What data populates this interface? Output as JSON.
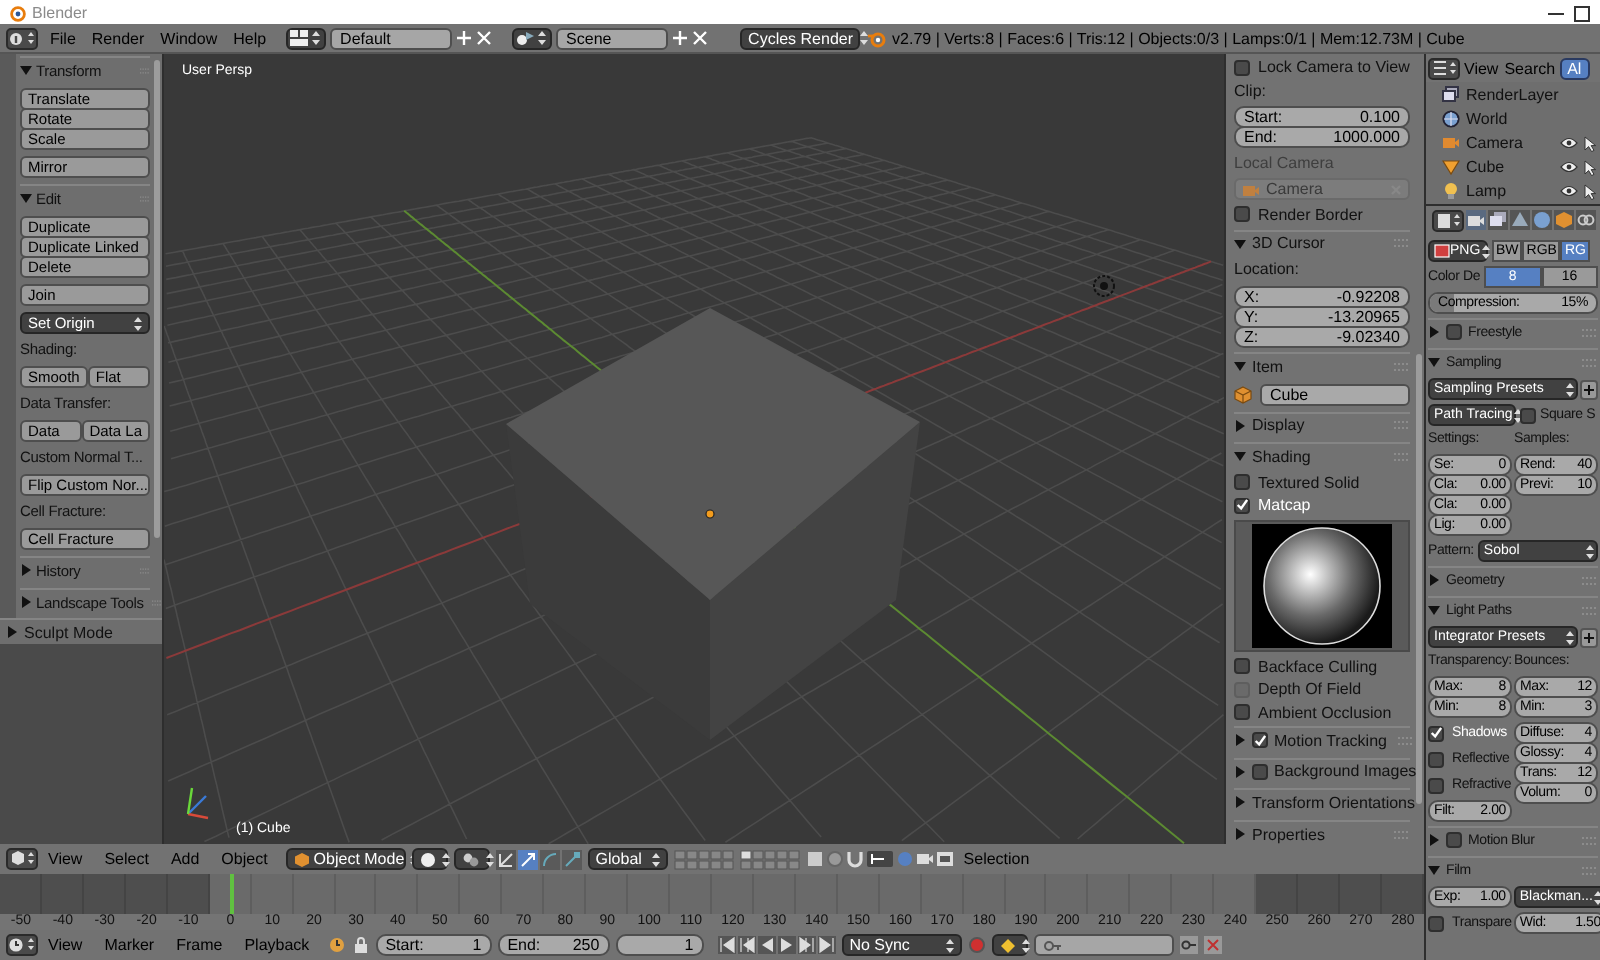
{
  "window": {
    "title": "Blender"
  },
  "info_header": {
    "menus": [
      "File",
      "Render",
      "Window",
      "Help"
    ],
    "layout": "Default",
    "scene": "Scene",
    "engine": "Cycles Render",
    "stats": "v2.79 | Verts:8 | Faces:6 | Tris:12 | Objects:0/3 | Lamps:0/1 | Mem:12.73M | Cube"
  },
  "tool_shelf": {
    "rows": [
      {
        "kind": "panel",
        "label": "Transform",
        "expanded": true
      },
      {
        "kind": "stack",
        "buttons": [
          "Translate",
          "Rotate",
          "Scale"
        ]
      },
      {
        "kind": "stack",
        "buttons": [
          "Mirror"
        ]
      },
      {
        "kind": "panel",
        "label": "Edit",
        "expanded": true
      },
      {
        "kind": "stack",
        "buttons": [
          "Duplicate",
          "Duplicate Linked",
          "Delete"
        ]
      },
      {
        "kind": "stack",
        "buttons": [
          "Join"
        ]
      },
      {
        "kind": "select",
        "label": "Set Origin"
      },
      {
        "kind": "label",
        "label": "Shading:"
      },
      {
        "kind": "row",
        "buttons": [
          "Smooth",
          "Flat"
        ]
      },
      {
        "kind": "label",
        "label": "Data Transfer:"
      },
      {
        "kind": "row",
        "buttons": [
          "Data",
          "Data La"
        ]
      },
      {
        "kind": "label",
        "label": "Custom Normal T..."
      },
      {
        "kind": "stack",
        "buttons": [
          "Flip Custom Nor..."
        ]
      },
      {
        "kind": "label",
        "label": "Cell Fracture:"
      },
      {
        "kind": "stack",
        "buttons": [
          "Cell Fracture"
        ]
      },
      {
        "kind": "panel",
        "label": "History",
        "expanded": false
      },
      {
        "kind": "panel",
        "label": "Landscape Tools",
        "expanded": false
      }
    ],
    "mode_panel": {
      "label": "Sculpt Mode",
      "expanded": false
    }
  },
  "viewport": {
    "view_name": "User Persp",
    "object_name": "(1) Cube"
  },
  "n_panel": {
    "rows": [
      {
        "kind": "check",
        "label": "Lock Camera to View",
        "checked": false
      },
      {
        "kind": "label",
        "label": "Clip:"
      },
      {
        "kind": "numbers",
        "fields": [
          {
            "label": "Start:",
            "value": "0.100"
          },
          {
            "label": "End:",
            "value": "1000.000"
          }
        ]
      },
      {
        "kind": "label",
        "label": "Local Camera",
        "disabled": true
      },
      {
        "kind": "object_field",
        "label": "Camera",
        "disabled": true
      },
      {
        "kind": "check",
        "label": "Render Border",
        "checked": false
      },
      {
        "kind": "panel",
        "label": "3D Cursor",
        "expanded": true
      },
      {
        "kind": "label",
        "label": "Location:"
      },
      {
        "kind": "numbers",
        "fields": [
          {
            "label": "X:",
            "value": "-0.92208"
          },
          {
            "label": "Y:",
            "value": "-13.20965"
          },
          {
            "label": "Z:",
            "value": "-9.02340"
          }
        ]
      },
      {
        "kind": "panel",
        "label": "Item",
        "expanded": true
      },
      {
        "kind": "name_field",
        "value": "Cube"
      },
      {
        "kind": "panel",
        "label": "Display",
        "expanded": false
      },
      {
        "kind": "panel",
        "label": "Shading",
        "expanded": true
      },
      {
        "kind": "check",
        "label": "Textured Solid",
        "checked": false
      },
      {
        "kind": "check",
        "label": "Matcap",
        "checked": true
      },
      {
        "kind": "preview"
      },
      {
        "kind": "check",
        "label": "Backface Culling",
        "checked": false
      },
      {
        "kind": "check",
        "label": "Depth Of Field",
        "checked": false,
        "disabled": true
      },
      {
        "kind": "check",
        "label": "Ambient Occlusion",
        "checked": false
      },
      {
        "kind": "panel",
        "label": "Motion Tracking",
        "expanded": false,
        "checked": true
      },
      {
        "kind": "panel",
        "label": "Background Images",
        "expanded": false,
        "checked": false
      },
      {
        "kind": "panel",
        "label": "Transform Orientations",
        "expanded": false
      },
      {
        "kind": "panel",
        "label": "Properties",
        "expanded": false
      }
    ]
  },
  "view3d_header": {
    "menus": [
      "View",
      "Select",
      "Add",
      "Object"
    ],
    "mode": "Object Mode",
    "orientation": "Global",
    "label": "Selection"
  },
  "timeline": {
    "ticks": [
      {
        "label": "-50",
        "in_range": false,
        "current": false
      },
      {
        "label": "-40",
        "in_range": false,
        "current": false
      },
      {
        "label": "-30",
        "in_range": false,
        "current": false
      },
      {
        "label": "-20",
        "in_range": false,
        "current": false
      },
      {
        "label": "-10",
        "in_range": false,
        "current": false
      },
      {
        "label": "0",
        "in_range": true,
        "current": true
      },
      {
        "label": "10",
        "in_range": true,
        "current": false
      },
      {
        "label": "20",
        "in_range": true,
        "current": false
      },
      {
        "label": "30",
        "in_range": true,
        "current": false
      },
      {
        "label": "40",
        "in_range": true,
        "current": false
      },
      {
        "label": "50",
        "in_range": true,
        "current": false
      },
      {
        "label": "60",
        "in_range": true,
        "current": false
      },
      {
        "label": "70",
        "in_range": true,
        "current": false
      },
      {
        "label": "80",
        "in_range": true,
        "current": false
      },
      {
        "label": "90",
        "in_range": true,
        "current": false
      },
      {
        "label": "100",
        "in_range": true,
        "current": false
      },
      {
        "label": "110",
        "in_range": true,
        "current": false
      },
      {
        "label": "120",
        "in_range": true,
        "current": false
      },
      {
        "label": "130",
        "in_range": true,
        "current": false
      },
      {
        "label": "140",
        "in_range": true,
        "current": false
      },
      {
        "label": "150",
        "in_range": true,
        "current": false
      },
      {
        "label": "160",
        "in_range": true,
        "current": false
      },
      {
        "label": "170",
        "in_range": true,
        "current": false
      },
      {
        "label": "180",
        "in_range": true,
        "current": false
      },
      {
        "label": "190",
        "in_range": true,
        "current": false
      },
      {
        "label": "200",
        "in_range": true,
        "current": false
      },
      {
        "label": "210",
        "in_range": true,
        "current": false
      },
      {
        "label": "220",
        "in_range": true,
        "current": false
      },
      {
        "label": "230",
        "in_range": true,
        "current": false
      },
      {
        "label": "240",
        "in_range": true,
        "current": false
      },
      {
        "label": "250",
        "in_range": false,
        "current": false
      },
      {
        "label": "260",
        "in_range": false,
        "current": false
      },
      {
        "label": "270",
        "in_range": false,
        "current": false
      },
      {
        "label": "280",
        "in_range": false,
        "current": false
      }
    ]
  },
  "timeline_header": {
    "menus": [
      "View",
      "Marker",
      "Frame",
      "Playback"
    ],
    "start": {
      "label": "Start:",
      "value": "1"
    },
    "end": {
      "label": "End:",
      "value": "250"
    },
    "frame": "1",
    "sync": "No Sync"
  },
  "outliner": {
    "menus": [
      "View",
      "Search"
    ],
    "filter": "Al",
    "items": [
      {
        "label": "RenderLayer",
        "kind": "renderlayer"
      },
      {
        "label": "World",
        "kind": "world"
      },
      {
        "label": "Camera",
        "kind": "camera"
      },
      {
        "label": "Cube",
        "kind": "mesh"
      },
      {
        "label": "Lamp",
        "kind": "lamp"
      }
    ]
  },
  "properties": {
    "rows": [
      {
        "kind": "format",
        "select": "PNG",
        "options": [
          {
            "label": "BW",
            "selected": false
          },
          {
            "label": "RGB",
            "selected": false
          },
          {
            "label": "RG",
            "selected": true
          }
        ]
      },
      {
        "kind": "toggle",
        "label": "Color De",
        "options": [
          {
            "label": "8",
            "selected": true
          },
          {
            "label": "16",
            "selected": false
          }
        ]
      },
      {
        "kind": "slider",
        "label": "Compression:",
        "value": "15%",
        "level": 0.15
      },
      {
        "kind": "panel",
        "label": "Freestyle",
        "expanded": false,
        "checked": false
      },
      {
        "kind": "panel",
        "label": "Sampling",
        "expanded": true
      },
      {
        "kind": "preset",
        "label": "Sampling Presets"
      },
      {
        "kind": "select_check",
        "select": "Path Tracing",
        "label": "Square S",
        "checked": false
      },
      {
        "kind": "columns",
        "columns": [
          {
            "rows": [
              {
                "kind": "label",
                "label": "Settings:"
              },
              {
                "kind": "numbers",
                "fields": [
                  {
                    "label": "Se:",
                    "value": "0"
                  },
                  {
                    "label": "Cla:",
                    "value": "0.00"
                  },
                  {
                    "label": "Cla:",
                    "value": "0.00"
                  },
                  {
                    "label": "Lig:",
                    "value": "0.00"
                  }
                ]
              }
            ]
          },
          {
            "rows": [
              {
                "kind": "label",
                "label": "Samples:"
              },
              {
                "kind": "numbers",
                "fields": [
                  {
                    "label": "Rend:",
                    "value": "40"
                  },
                  {
                    "label": "Previ:",
                    "value": "10"
                  }
                ]
              }
            ]
          }
        ]
      },
      {
        "kind": "labeled_select",
        "label": "Pattern:",
        "select": "Sobol"
      },
      {
        "kind": "panel",
        "label": "Geometry",
        "expanded": false
      },
      {
        "kind": "panel",
        "label": "Light Paths",
        "expanded": true
      },
      {
        "kind": "preset",
        "label": "Integrator Presets"
      },
      {
        "kind": "columns",
        "columns": [
          {
            "rows": [
              {
                "kind": "label",
                "label": "Transparency:"
              },
              {
                "kind": "numbers",
                "fields": [
                  {
                    "label": "Max:",
                    "value": "8"
                  },
                  {
                    "label": "Min:",
                    "value": "8"
                  }
                ]
              },
              {
                "kind": "check",
                "label": "Shadows",
                "checked": true
              },
              {
                "kind": "check",
                "label": "Reflective",
                "checked": false
              },
              {
                "kind": "check",
                "label": "Refractive",
                "checked": false
              },
              {
                "kind": "numbers",
                "fields": [
                  {
                    "label": "Filt:",
                    "value": "2.00"
                  }
                ]
              }
            ]
          },
          {
            "rows": [
              {
                "kind": "label",
                "label": "Bounces:"
              },
              {
                "kind": "numbers",
                "fields": [
                  {
                    "label": "Max:",
                    "value": "12"
                  },
                  {
                    "label": "Min:",
                    "value": "3"
                  }
                ]
              },
              {
                "kind": "numbers",
                "fields": [
                  {
                    "label": "Diffuse:",
                    "value": "4"
                  },
                  {
                    "label": "Glossy:",
                    "value": "4"
                  },
                  {
                    "label": "Trans:",
                    "value": "12"
                  },
                  {
                    "label": "Volum:",
                    "value": "0"
                  }
                ]
              }
            ]
          }
        ]
      },
      {
        "kind": "panel",
        "label": "Motion Blur",
        "expanded": false,
        "checked": false
      },
      {
        "kind": "panel",
        "label": "Film",
        "expanded": true
      },
      {
        "kind": "columns",
        "columns": [
          {
            "rows": [
              {
                "kind": "numbers",
                "fields": [
                  {
                    "label": "Exp:",
                    "value": "1.00"
                  }
                ]
              },
              {
                "kind": "check",
                "label": "Transpare",
                "checked": false
              }
            ]
          },
          {
            "rows": [
              {
                "kind": "select",
                "label": "Blackman..."
              },
              {
                "kind": "numbers",
                "fields": [
                  {
                    "label": "Wid:",
                    "value": "1.50"
                  }
                ]
              }
            ]
          }
        ]
      }
    ]
  }
}
